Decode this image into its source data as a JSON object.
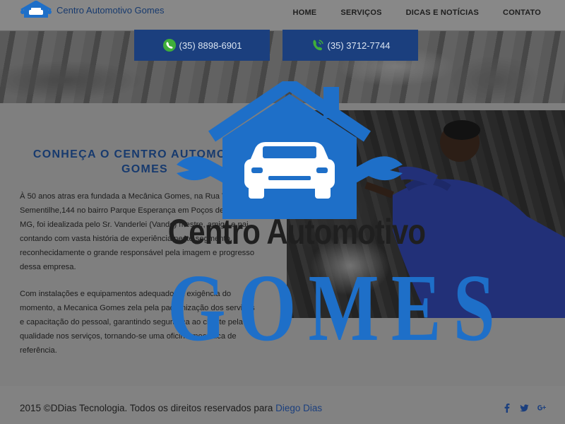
{
  "header": {
    "brand": "Centro Automotivo Gomes",
    "nav": [
      "HOME",
      "SERVIÇOS",
      "DICAS E NOTÍCIAS",
      "CONTATO"
    ]
  },
  "contacts": {
    "phone_whatsapp": "(35) 8898-6901",
    "phone_landline": "(35) 3712-7744"
  },
  "about": {
    "heading": "CONHEÇA O CENTRO AUTOMOTIVO GOMES",
    "paragraph1": "À 50 anos atras era fundada a Mecânica Gomes, na Rua Vilma Sementilhe,144 no bairro Parque Esperança em Poços de Caldas - MG, foi idealizada pelo Sr. Vanderlei (Vando) mestre, amigo e pai, contando com vasta história de experiência neste segmento, reconhecidamente o grande responsável pela imagem e progresso dessa empresa.",
    "paragraph2": "Com instalações e equipamentos adequados à exigência do momento, a Mecanica Gomes zela pela padronização dos serviços e capacitação do pessoal, garantindo segurança ao cliente pela qualidade nos serviços, tornando-se uma oficina mecânica de referência."
  },
  "logo": {
    "line1": "Centro Automotivo",
    "line2": "GOMES"
  },
  "footer": {
    "copyright": "2015 ©DDias Tecnologia. Todos os direitos reservados para ",
    "author": "Diego Dias",
    "social_icons": [
      "facebook-icon",
      "twitter-icon",
      "google-plus-icon"
    ]
  },
  "colors": {
    "brand_blue": "#1e6fc8",
    "dark_blue": "#1b3f7e",
    "overlay_gray": "#7f7f7f"
  }
}
